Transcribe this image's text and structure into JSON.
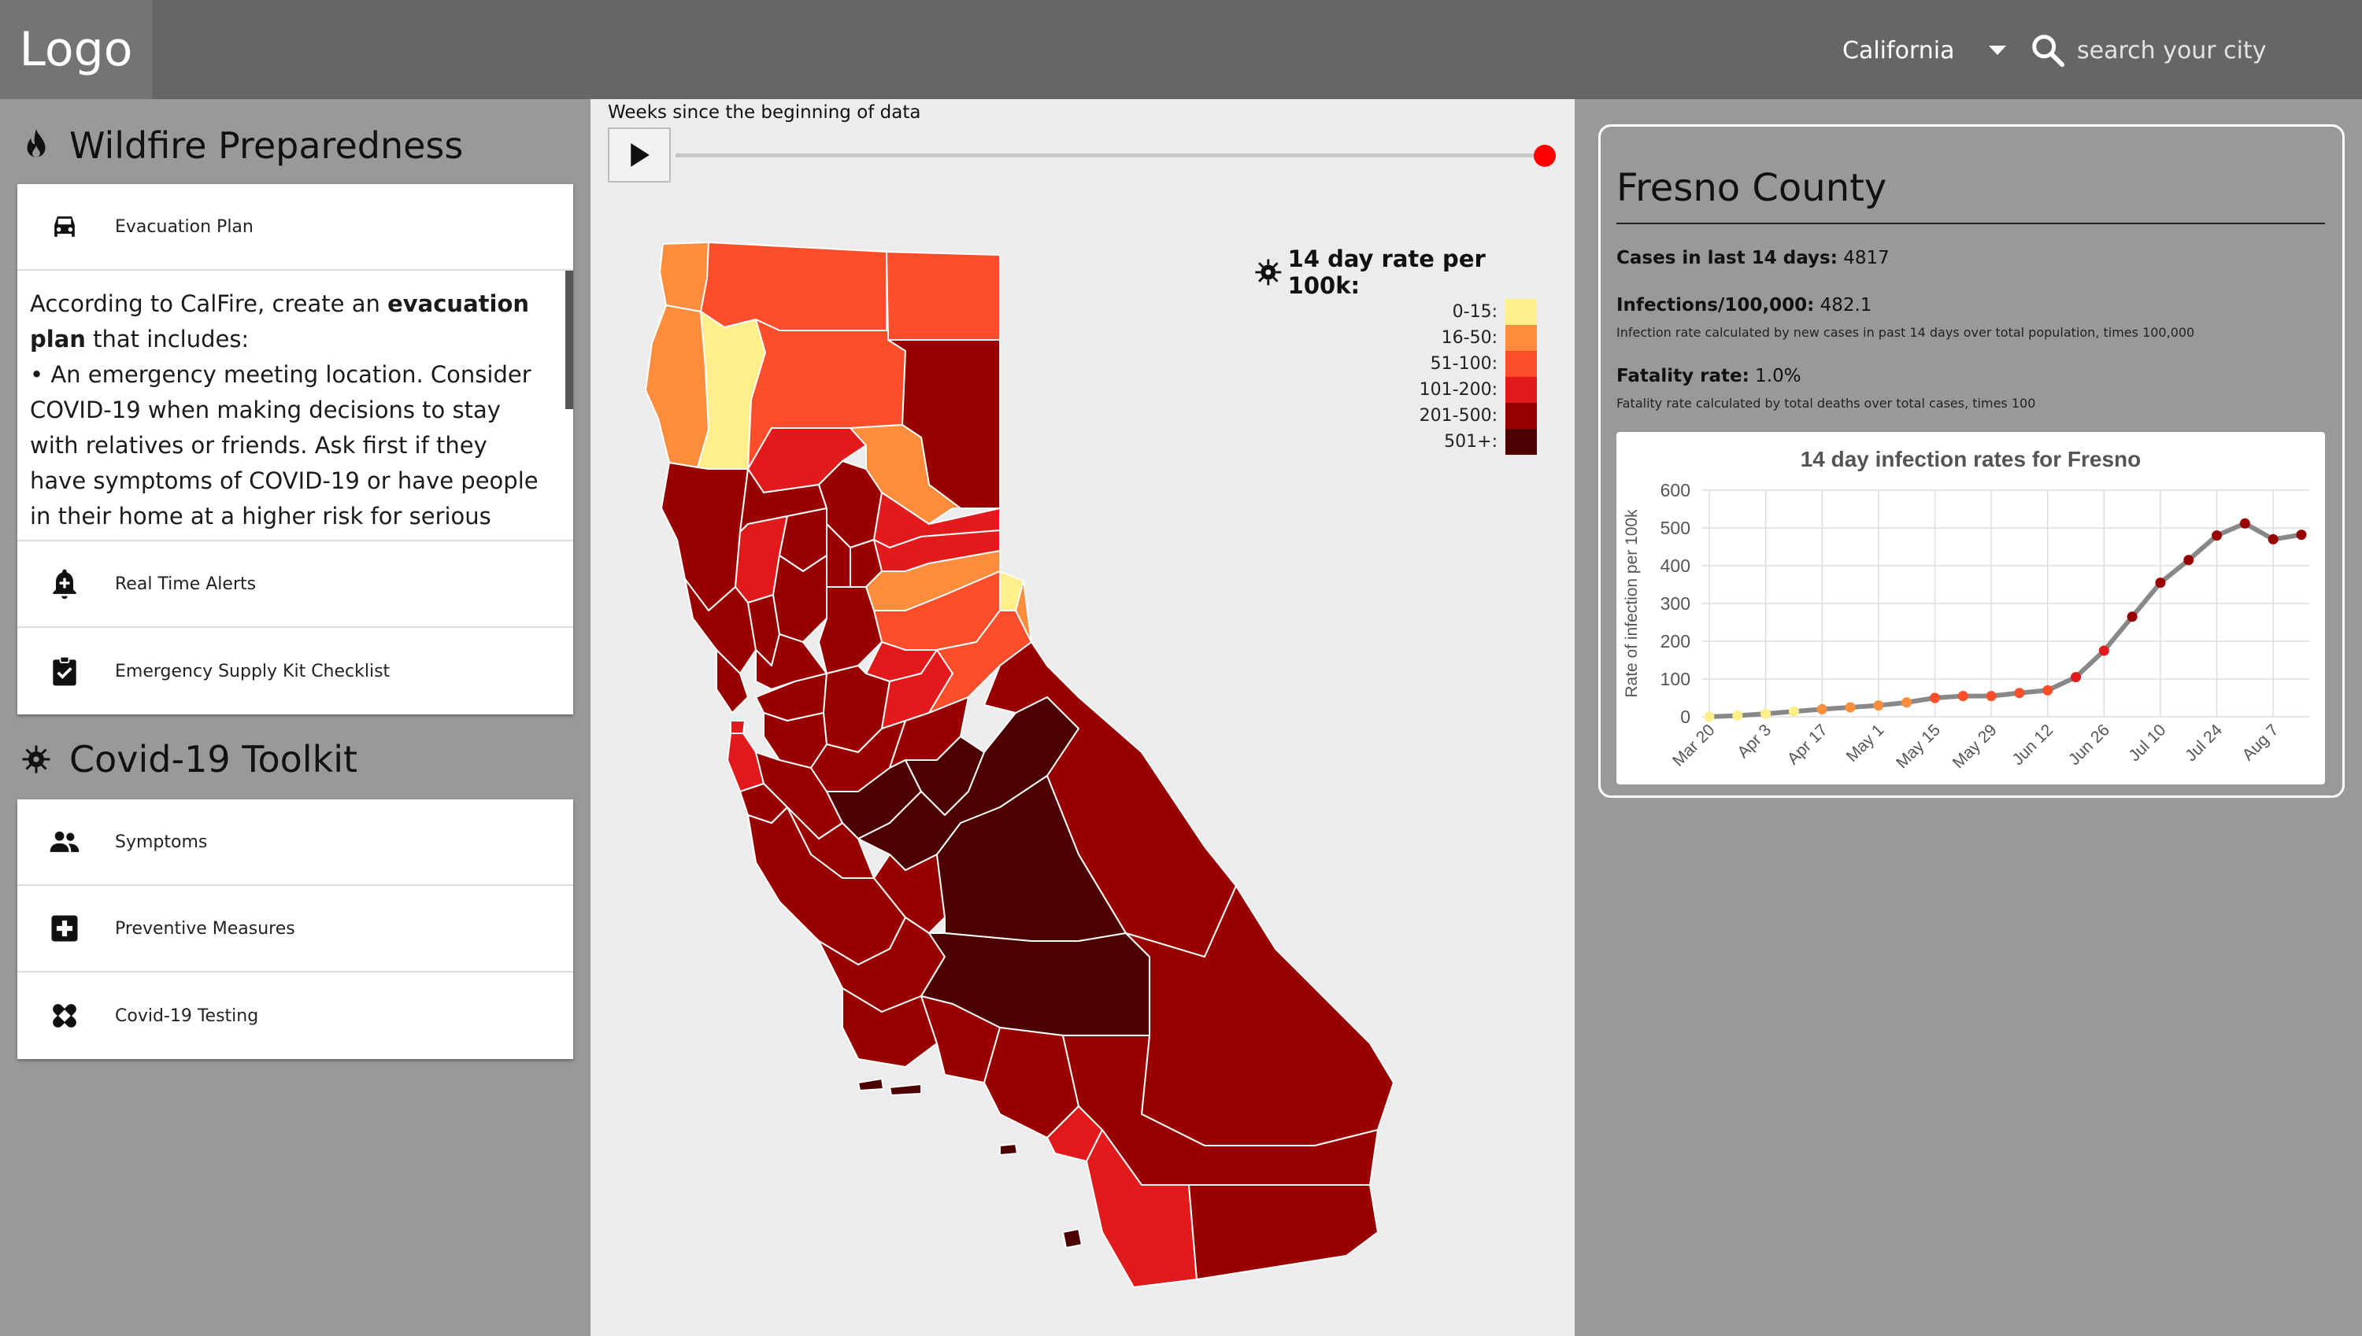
{
  "header": {
    "logo": "Logo",
    "state": "California",
    "search_placeholder": "search your city"
  },
  "sidebar": {
    "wildfire": {
      "title": "Wildfire Preparedness",
      "items": [
        {
          "label": "Evacuation Plan",
          "icon": "car-icon"
        },
        {
          "label": "Real Time Alerts",
          "icon": "bell-icon"
        },
        {
          "label": "Emergency Supply Kit Checklist",
          "icon": "clipboard-check-icon"
        }
      ],
      "evac_text": {
        "intro_before": "According to CalFire, create an ",
        "intro_bold": "evacuation plan",
        "intro_after": " that includes:",
        "bullet": "• An emergency meeting location. Consider COVID-19 when making decisions to stay with relatives or friends. Ask first if they have symptoms of COVID-19 or have people in their home at a higher risk for serious illness."
      }
    },
    "covid": {
      "title": "Covid-19 Toolkit",
      "items": [
        {
          "label": "Symptoms",
          "icon": "people-icon"
        },
        {
          "label": "Preventive Measures",
          "icon": "medical-plus-icon"
        },
        {
          "label": "Covid-19 Testing",
          "icon": "bandage-icon"
        }
      ]
    }
  },
  "map": {
    "slider_caption": "Weeks since the beginning of data",
    "slider_position": 1.0,
    "legend": {
      "title": "14 day rate per 100k:",
      "items": [
        {
          "label": "0-15:",
          "color": "#ffef8a"
        },
        {
          "label": "16-50:",
          "color": "#fc8d3c"
        },
        {
          "label": "51-100:",
          "color": "#fc4e2a"
        },
        {
          "label": "101-200:",
          "color": "#e31a1c"
        },
        {
          "label": "201-500:",
          "color": "#990000"
        },
        {
          "label": "501+:",
          "color": "#4d0000"
        }
      ]
    }
  },
  "county": {
    "name": "Fresno County",
    "cases_label": "Cases in last 14 days:",
    "cases_value": "4817",
    "infections_label": "Infections/100,000:",
    "infections_value": "482.1",
    "infections_note": "Infection rate calculated by new cases in past 14 days over total population, times 100,000",
    "fatality_label": "Fatality rate:",
    "fatality_value": "1.0%",
    "fatality_note": "Fatality rate calculated by total deaths over total cases, times 100"
  },
  "chart_data": {
    "type": "line",
    "title": "14 day infection rates for Fresno",
    "ylabel": "Rate of infection per 100k",
    "xlabel": "",
    "ylim": [
      0,
      600
    ],
    "yticks": [
      0,
      100,
      200,
      300,
      400,
      500,
      600
    ],
    "xtick_labels": [
      "Mar 20",
      "Apr 3",
      "Apr 17",
      "May 1",
      "May 15",
      "May 29",
      "Jun 12",
      "Jun 26",
      "Jul 10",
      "Jul 24",
      "Aug 7"
    ],
    "grid": true,
    "values": [
      0,
      3,
      8,
      14,
      20,
      25,
      30,
      38,
      50,
      55,
      55,
      63,
      70,
      105,
      175,
      265,
      355,
      415,
      480,
      512,
      470,
      482
    ],
    "point_colors": [
      "#ffef8a",
      "#ffef8a",
      "#ffef8a",
      "#ffef8a",
      "#fc8d3c",
      "#fc8d3c",
      "#fc8d3c",
      "#fc8d3c",
      "#fc4e2a",
      "#fc4e2a",
      "#fc4e2a",
      "#fc4e2a",
      "#fc4e2a",
      "#e31a1c",
      "#e31a1c",
      "#990000",
      "#990000",
      "#990000",
      "#990000",
      "#990000",
      "#990000",
      "#990000"
    ],
    "line_color": "#888888"
  }
}
